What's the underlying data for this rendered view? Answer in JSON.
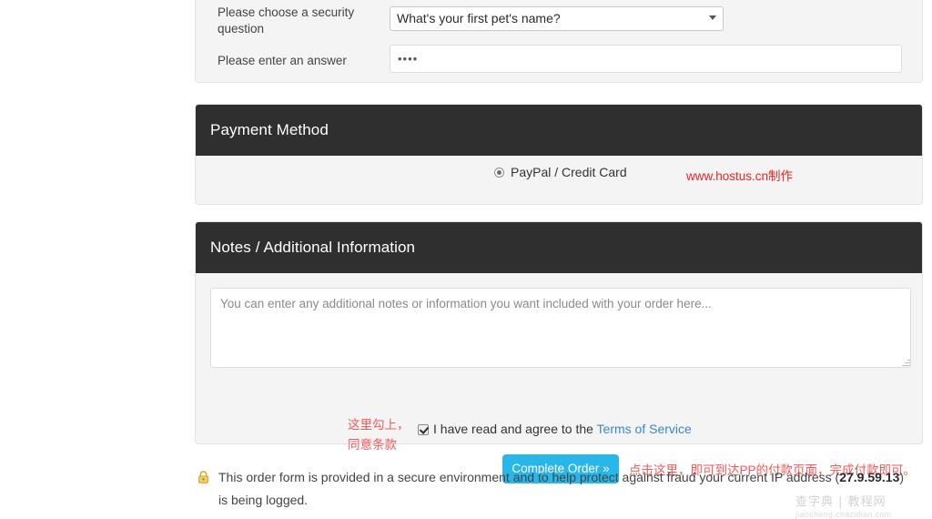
{
  "security_panel": {
    "question_label": "Please choose a security question",
    "question_value": "What's your first pet's name?",
    "question_options": [
      "What's your first pet's name?"
    ],
    "answer_label": "Please enter an answer",
    "answer_value": "••••",
    "answer_placeholder": ""
  },
  "payment": {
    "header": "Payment Method",
    "option_label": "PayPal / Credit Card",
    "option_selected": true,
    "annotation": "www.hostus.cn制作",
    "annotation_color": "#ee2222"
  },
  "notes": {
    "header": "Notes / Additional Information",
    "textarea_value": "",
    "textarea_placeholder": "You can enter any additional notes or information you want included with your order here...",
    "tos_prefix": "I have read and agree to the ",
    "tos_link": "Terms of Service",
    "tos_checked": true,
    "annotation_left_line1": "这里勾上，",
    "annotation_left_line2": "同意条款",
    "submit_label": "Complete Order »",
    "submit_color": "#29b6e8",
    "annotation_right": "点击这里，即可到达PP的付款页面，完成付款即可。",
    "annotation_color": "#f05a5a"
  },
  "footer": {
    "icon": "lock-icon",
    "text_part1": "This order form is provided in a secure environment and to help protect against fraud your current IP address (",
    "ip_address": "27.9.59.13",
    "text_part2": ") is being logged."
  },
  "watermark": {
    "top": "查字典 | 教程网",
    "bottom": "jiaocheng.chazidian.com"
  }
}
